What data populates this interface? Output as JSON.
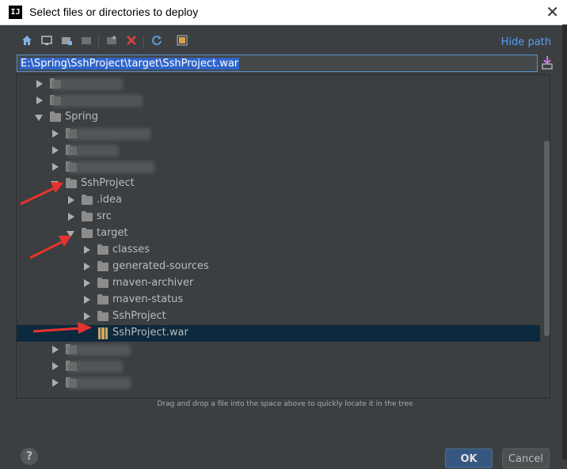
{
  "window": {
    "logo": "IJ",
    "title": "Select files or directories to deploy",
    "close_label": "✕"
  },
  "toolbar": {
    "icons": [
      "home-icon",
      "desktop-icon",
      "project-folder-icon",
      "module-folder-icon",
      "new-folder-icon",
      "delete-icon",
      "refresh-icon",
      "show-hidden-icon"
    ],
    "hide_path_label": "Hide path"
  },
  "path": {
    "value": "E:\\Spring\\SshProject\\target\\SshProject.war"
  },
  "tree": {
    "rows": [
      {
        "label": "",
        "blurred": true,
        "state": "collapsed",
        "depth": 1
      },
      {
        "label": "",
        "blurred": true,
        "state": "collapsed",
        "depth": 1
      },
      {
        "label": "Spring",
        "state": "expanded",
        "depth": 1
      },
      {
        "label": "",
        "blurred": true,
        "state": "collapsed",
        "depth": 2
      },
      {
        "label": "",
        "blurred": true,
        "state": "collapsed",
        "depth": 2
      },
      {
        "label": "",
        "blurred": true,
        "state": "collapsed",
        "depth": 2
      },
      {
        "label": "SshProject",
        "state": "expanded",
        "depth": 2
      },
      {
        "label": ".idea",
        "state": "collapsed",
        "depth": 3
      },
      {
        "label": "src",
        "state": "collapsed",
        "depth": 3
      },
      {
        "label": "target",
        "state": "expanded",
        "depth": 3
      },
      {
        "label": "classes",
        "state": "collapsed",
        "depth": 4
      },
      {
        "label": "generated-sources",
        "state": "collapsed",
        "depth": 4
      },
      {
        "label": "maven-archiver",
        "state": "collapsed",
        "depth": 4
      },
      {
        "label": "maven-status",
        "state": "collapsed",
        "depth": 4
      },
      {
        "label": "SshProject",
        "state": "collapsed",
        "depth": 4
      },
      {
        "label": "SshProject.war",
        "state": "leaf",
        "depth": 4,
        "selected": true
      },
      {
        "label": "",
        "blurred": true,
        "state": "collapsed",
        "depth": 2
      },
      {
        "label": "",
        "blurred": true,
        "state": "collapsed",
        "depth": 2
      },
      {
        "label": "",
        "blurred": true,
        "state": "collapsed",
        "depth": 2
      }
    ]
  },
  "hint": "Drag and drop a file into the space above to quickly locate it in the tree",
  "buttons": {
    "help": "?",
    "ok": "OK",
    "cancel": "Cancel"
  },
  "colors": {
    "accent_link": "#589df6",
    "selection": "#0d293e",
    "annotation_arrow": "#e8322f"
  }
}
